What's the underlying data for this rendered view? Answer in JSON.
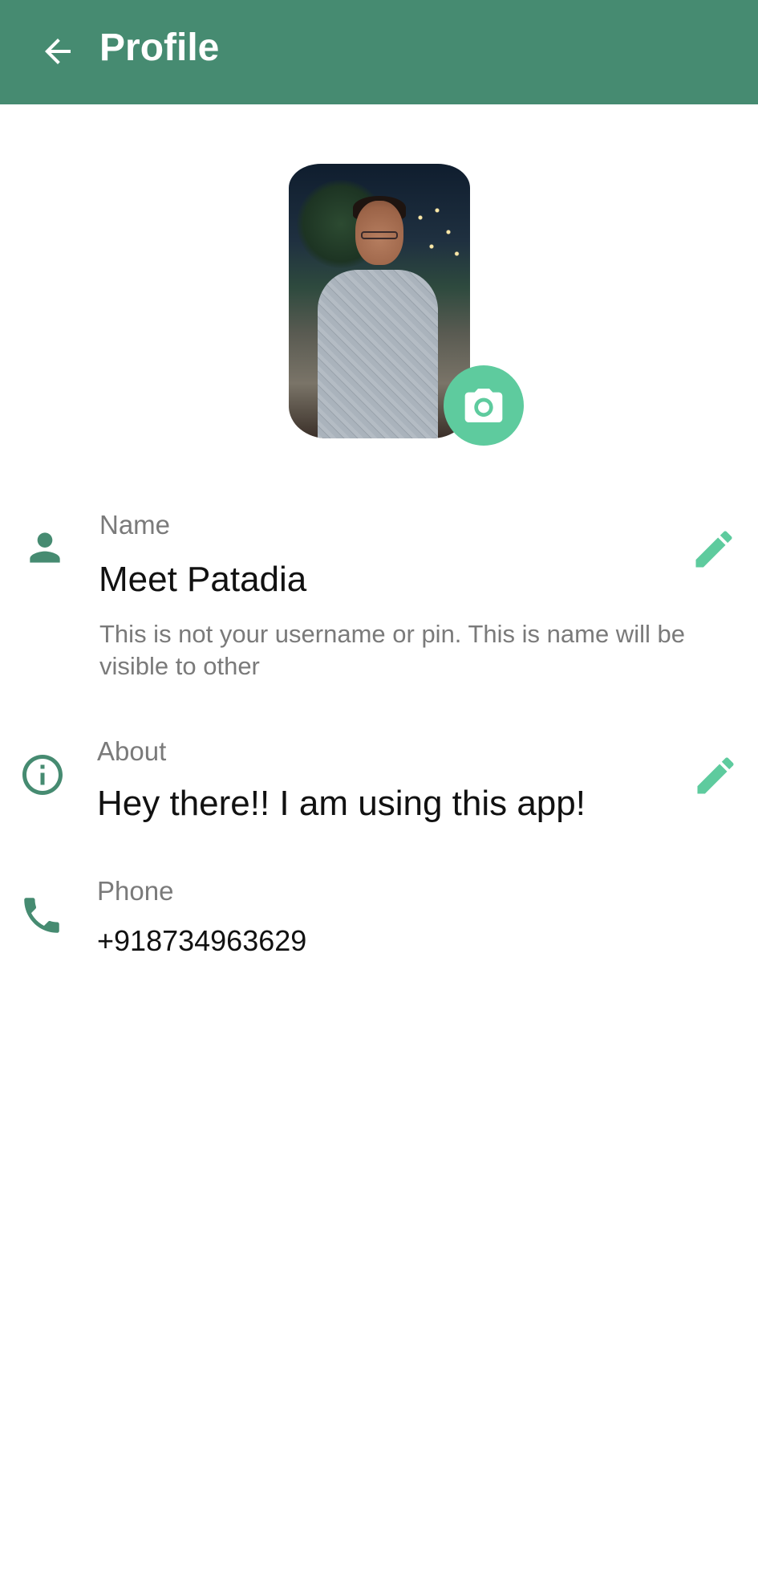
{
  "appbar": {
    "title": "Profile",
    "back_icon": "arrow-back-icon",
    "bg_color": "#468b71"
  },
  "profile_photo": {
    "camera_icon": "camera-icon",
    "accent_color": "#5ecb9e"
  },
  "fields": {
    "name": {
      "label": "Name",
      "value": "Meet Patadia",
      "hint": "This is not your username or pin. This is name will be visible to other",
      "icon": "person-icon",
      "edit_icon": "pencil-icon"
    },
    "about": {
      "label": "About",
      "value": "Hey there!! I am using this app!",
      "icon": "info-icon",
      "edit_icon": "pencil-icon"
    },
    "phone": {
      "label": "Phone",
      "value": "+918734963629",
      "icon": "phone-icon"
    }
  }
}
